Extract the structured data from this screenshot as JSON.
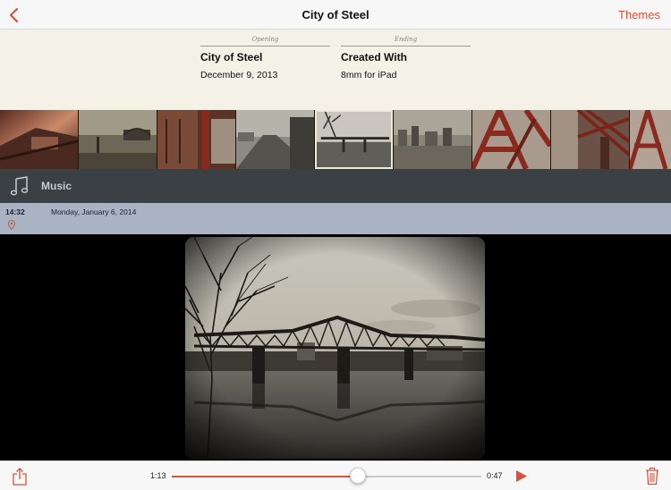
{
  "navbar": {
    "title": "City of Steel",
    "back_icon": "chevron-left-icon",
    "themes_label": "Themes"
  },
  "title_cards": {
    "opening": {
      "caption": "Opening",
      "title": "City of Steel",
      "subtitle": "December 9, 2013"
    },
    "ending": {
      "caption": "Ending",
      "title": "Created With",
      "subtitle": "8mm for iPad"
    }
  },
  "filmstrip": {
    "frame_count": 9,
    "selected_index": 4
  },
  "music": {
    "icon": "music-note-icon",
    "label": "Music"
  },
  "clip": {
    "time": "14:32",
    "date": "Monday, January 6, 2014",
    "location_icon": "location-pin-icon"
  },
  "playback": {
    "elapsed": "1:13",
    "remaining": "0:47",
    "progress": 0.6
  },
  "colors": {
    "accent": "#d9533c",
    "card_background": "#f4f1e6",
    "music_bar": "#3a4043",
    "clip_bar": "#a9b3c3"
  },
  "icons": {
    "share": "share-icon",
    "play": "play-icon",
    "trash": "trash-icon"
  }
}
